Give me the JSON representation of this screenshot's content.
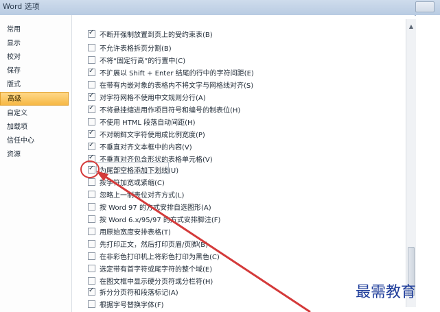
{
  "window": {
    "title": "Word 选项"
  },
  "sidebar": {
    "items": [
      {
        "label": "常用"
      },
      {
        "label": "显示"
      },
      {
        "label": "校对"
      },
      {
        "label": "保存"
      },
      {
        "label": "版式"
      },
      {
        "label": "高级",
        "selected": true
      },
      {
        "label": "自定义"
      },
      {
        "label": "加载项"
      },
      {
        "label": "信任中心"
      },
      {
        "label": "资源"
      }
    ]
  },
  "options": [
    {
      "label": "不断开强制放置到页上的受约束表(B)",
      "checked": true
    },
    {
      "label": "不允许表格拆页分割(B)",
      "checked": false
    },
    {
      "label": "不将“固定行高”的行置中(C)",
      "checked": false
    },
    {
      "label": "不扩展以 Shift + Enter 结尾的行中的字符间距(E)",
      "checked": true
    },
    {
      "label": "在带有内嵌对象的表格内不将文字与网格线对齐(S)",
      "checked": false
    },
    {
      "label": "对字符网格不使用中文规则分行(A)",
      "checked": true
    },
    {
      "label": "不将悬挂缩进用作项目符号和编号的制表位(H)",
      "checked": true
    },
    {
      "label": "不使用 HTML 段落自动间距(H)",
      "checked": false
    },
    {
      "label": "不对朝鲜文字符使用成比例宽度(P)",
      "checked": true
    },
    {
      "label": "不垂直对齐文本框中的内容(V)",
      "checked": true
    },
    {
      "label": "不垂直对齐包含形状的表格单元格(V)",
      "checked": true
    },
    {
      "label": "为尾部空格添加下划线(U)",
      "checked": true
    },
    {
      "label": "按字符加宽或紧缩(C)",
      "checked": false
    },
    {
      "label": "忽略上一制表位对齐方式(L)",
      "checked": false
    },
    {
      "label": "按 Word 97 的方式安排自选图形(A)",
      "checked": false
    },
    {
      "label": "按 Word 6.x/95/97 的方式安排脚注(F)",
      "checked": false
    },
    {
      "label": "用原始宽度安排表格(T)",
      "checked": false
    },
    {
      "label": "先打印正文，然后打印页眉/页脚(B)",
      "checked": false
    },
    {
      "label": "在非彩色打印机上将彩色打印为黑色(C)",
      "checked": false
    },
    {
      "label": "选定带有首字符或尾字符的整个域(E)",
      "checked": false
    },
    {
      "label": "在图文框中显示硬分页符或分栏符(H)",
      "checked": false
    },
    {
      "label": "拆分分页符和段落标记(A)",
      "checked": true
    },
    {
      "label": "根据字号替换字体(F)",
      "checked": false
    }
  ],
  "watermark": "最需教育",
  "colors": {
    "selected": "#f6b845",
    "annotation": "#d43a3a",
    "watermark": "#1f3d9a"
  }
}
